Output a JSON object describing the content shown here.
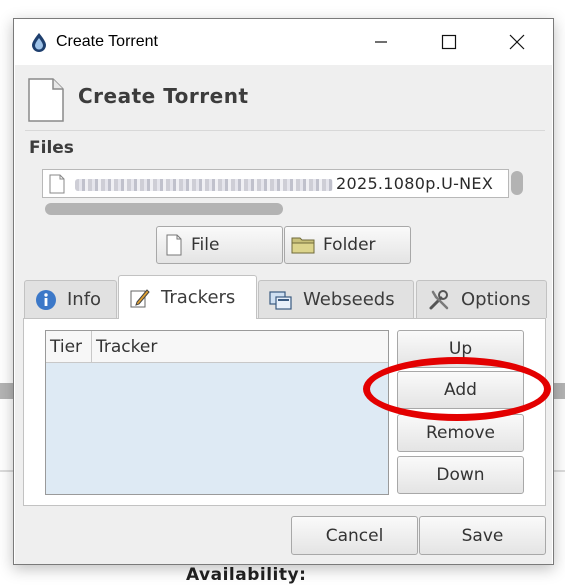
{
  "window": {
    "title": "Create Torrent"
  },
  "header": {
    "title": "Create Torrent"
  },
  "files": {
    "label": "Files",
    "filename_visible": "2025.1080p.U-NEX"
  },
  "buttons": {
    "file": "File",
    "folder": "Folder",
    "up": "Up",
    "add": "Add",
    "remove": "Remove",
    "down": "Down",
    "cancel": "Cancel",
    "save": "Save"
  },
  "tabs": [
    {
      "label": "Info",
      "icon": "info-icon",
      "active": false
    },
    {
      "label": "Trackers",
      "icon": "edit-icon",
      "active": true
    },
    {
      "label": "Webseeds",
      "icon": "webseeds-icon",
      "active": false
    },
    {
      "label": "Options",
      "icon": "tools-icon",
      "active": false
    }
  ],
  "tracker_table": {
    "columns": [
      "Tier",
      "Tracker"
    ],
    "rows": []
  },
  "background": {
    "partial_text": "Availability:"
  },
  "colors": {
    "highlight": "#e30000",
    "table_bg": "#deeaf4"
  }
}
